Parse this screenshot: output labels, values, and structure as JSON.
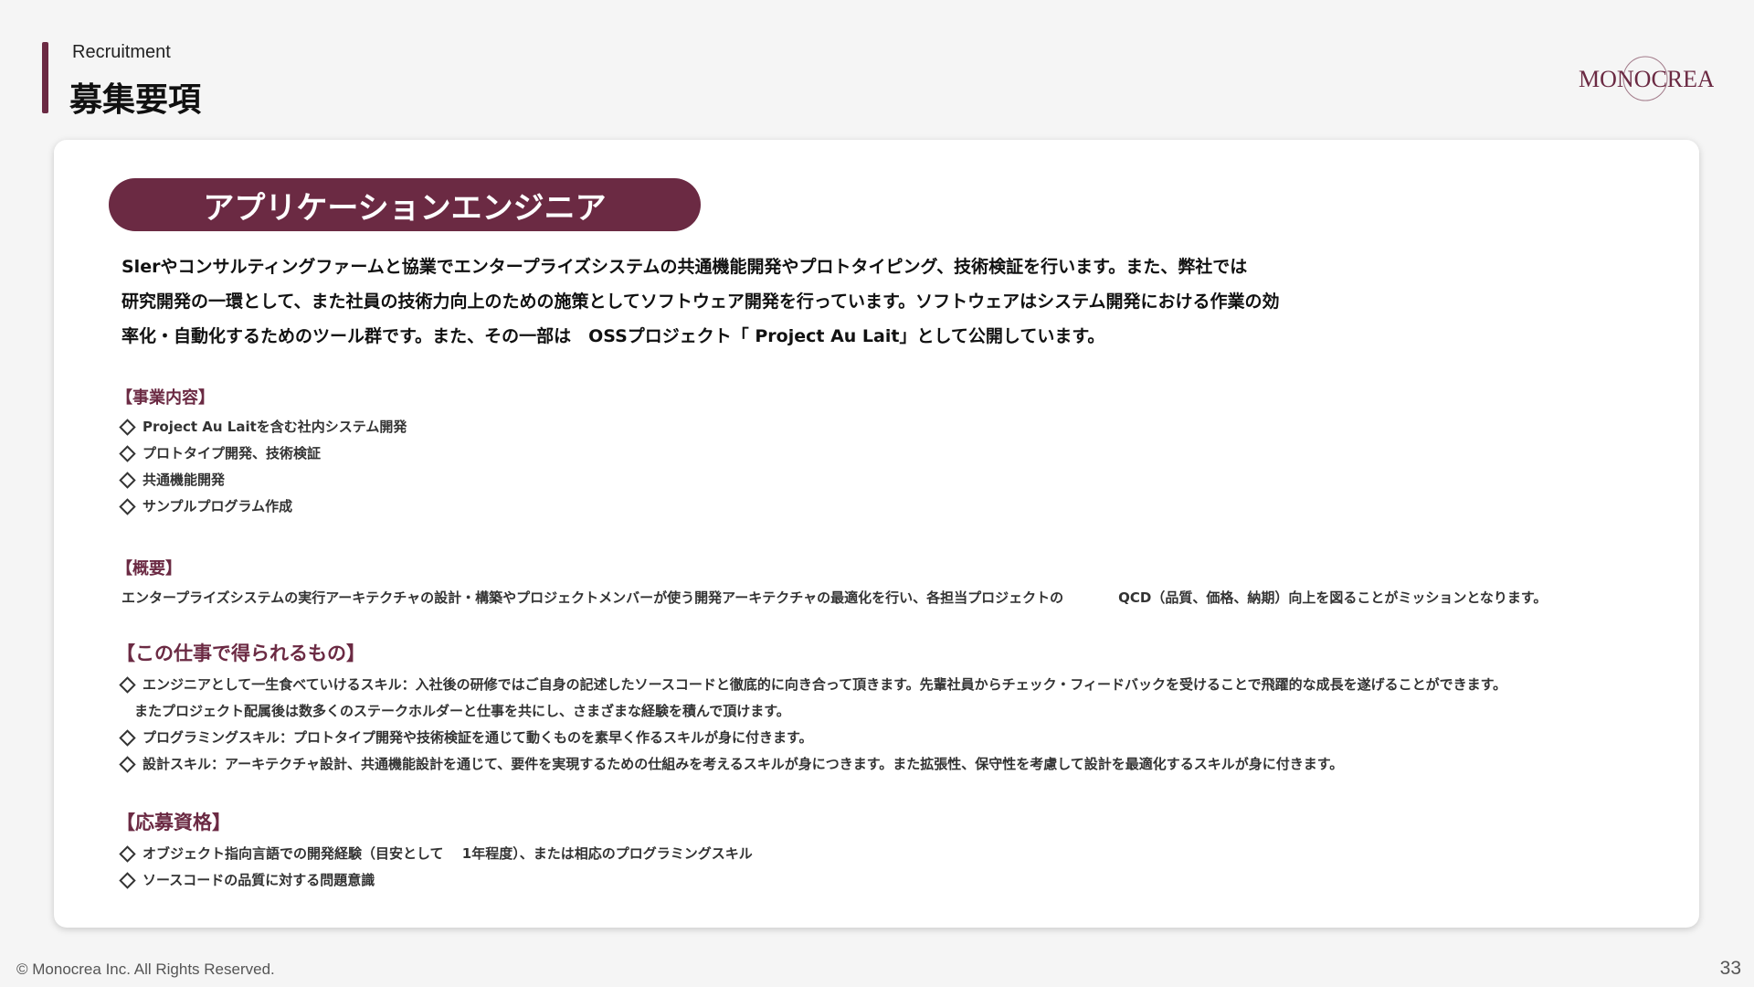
{
  "header": {
    "subtitle": "Recruitment",
    "title": "募集要項"
  },
  "logo": {
    "text": "MONOCREA"
  },
  "job": {
    "title": "アプリケーションエンジニア",
    "intro_lines": [
      "Slerやコンサルティングファームと協業でエンタープライズシステムの共通機能開発やプロトタイピング、技術検証を行います。また、弊社では",
      "研究開発の一環として、また社員の技術力向上のための施策としてソフトウェア開発を行っています。ソフトウェアはシステム開発における作業の効",
      "率化・自動化するためのツール群です。また、その一部は　OSSプロジェクト「 Project Au Lait」として公開しています。"
    ]
  },
  "business": {
    "heading": "【事業内容】",
    "items": [
      "Project Au Laitを含む社内システム開発",
      "プロトタイプ開発、技術検証",
      "共通機能開発",
      "サンプルプログラム作成"
    ]
  },
  "summary": {
    "heading": "【概要】",
    "text": "エンタープライズシステムの実行アーキテクチャの設計・構築やプロジェクトメンバーが使う開発アーキテクチャの最適化を行い、各担当プロジェクトの　　　　QCD（品質、価格、納期）向上を図ることがミッションとなります。"
  },
  "gains": {
    "heading": "【この仕事で得られるもの】",
    "items": [
      "エンジニアとして一生食べていけるスキル：入社後の研修ではご自身の記述したソースコードと徹底的に向き合って頂きます。先輩社員からチェック・フィードバックを受けることで飛躍的な成長を遂げることができます。",
      "プログラミングスキル：プロトタイプ開発や技術検証を通じて動くものを素早く作るスキルが身に付きます。",
      "設計スキル：アーキテクチャ設計、共通機能設計を通じて、要件を実現するための仕組みを考えるスキルが身につきます。また拡張性、保守性を考慮して設計を最適化するスキルが身に付きます。"
    ],
    "continuation": "またプロジェクト配属後は数多くのステークホルダーと仕事を共にし、さまざまな経験を積んで頂けます。"
  },
  "requirements": {
    "heading": "【応募資格】",
    "items": [
      "オブジェクト指向言語での開発経験（目安として　 1年程度）、または相応のプログラミングスキル",
      "ソースコードの品質に対する問題意識"
    ]
  },
  "footer": {
    "copyright": "© Monocrea Inc. All Rights Reserved.",
    "page_number": "33"
  },
  "colors": {
    "accent": "#6b2a43",
    "background": "#f5f5f5",
    "card": "#ffffff"
  }
}
